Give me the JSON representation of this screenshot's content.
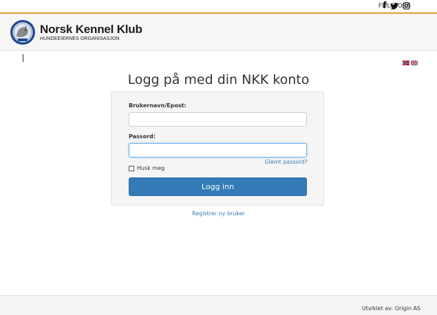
{
  "topbar": {
    "follow_label": "FØLG OSS",
    "social": [
      "facebook-icon",
      "twitter-icon",
      "instagram-icon"
    ]
  },
  "header": {
    "brand_name": "Norsk Kennel Klub",
    "brand_sub": "HUNDEEIERNES ORGANISASJON",
    "accent_color": "#e89a2c"
  },
  "language": {
    "options": [
      "norwegian-flag-icon",
      "uk-flag-icon"
    ]
  },
  "login": {
    "title": "Logg på med din NKK konto",
    "username_label": "Brukernavn/Epost:",
    "username_value": "",
    "password_label": "Passord:",
    "password_value": "",
    "forgot_link": "Glemt passord?",
    "remember_label": "Husk meg",
    "remember_checked": false,
    "submit_label": "Logg inn",
    "button_color": "#337ab7",
    "link_color": "#337ab7"
  },
  "register_link": "Registrer ny bruker",
  "footer": {
    "credit": "Utviklet av: Origin AS"
  }
}
